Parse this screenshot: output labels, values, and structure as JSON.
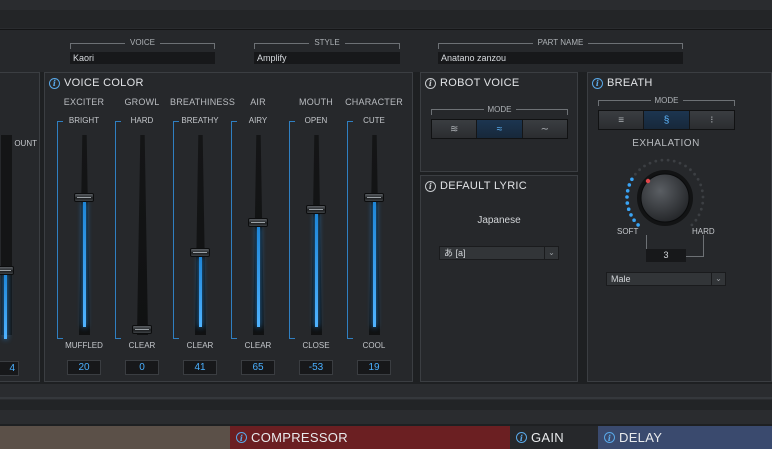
{
  "header": {
    "voice": {
      "caption": "VOICE",
      "value": "Kaori"
    },
    "style": {
      "caption": "STYLE",
      "value": "Amplify"
    },
    "part_name": {
      "caption": "PART NAME",
      "value": "Anatano zanzou"
    }
  },
  "left_partial": {
    "label": "OUNT",
    "value": "4"
  },
  "voice_color": {
    "title": "VOICE COLOR",
    "sliders": [
      {
        "name": "EXCITER",
        "top": "BRIGHT",
        "bottom": "MUFFLED",
        "value": "20",
        "level": 0.7
      },
      {
        "name": "GROWL",
        "top": "HARD",
        "bottom": "CLEAR",
        "value": "0",
        "level": 0.0
      },
      {
        "name": "BREATHINESS",
        "top": "BREATHY",
        "bottom": "CLEAR",
        "value": "41",
        "level": 0.41
      },
      {
        "name": "AIR",
        "top": "AIRY",
        "bottom": "CLEAR",
        "value": "65",
        "level": 0.57
      },
      {
        "name": "MOUTH",
        "top": "OPEN",
        "bottom": "CLOSE",
        "value": "-53",
        "level": 0.64
      },
      {
        "name": "CHARACTER",
        "top": "CUTE",
        "bottom": "COOL",
        "value": "19",
        "level": 0.7
      }
    ]
  },
  "robot_voice": {
    "title": "ROBOT VOICE",
    "mode_caption": "MODE",
    "modes": [
      {
        "icon": "wave-stack-icon",
        "glyph": "≋",
        "active": false
      },
      {
        "icon": "wave-double-icon",
        "glyph": "≈",
        "active": true
      },
      {
        "icon": "wave-single-icon",
        "glyph": "∼",
        "active": false
      }
    ]
  },
  "default_lyric": {
    "title": "DEFAULT LYRIC",
    "language": "Japanese",
    "selected": "あ [a]"
  },
  "breath": {
    "title": "BREATH",
    "mode_caption": "MODE",
    "modes": [
      {
        "icon": "wind-icon",
        "glyph": "≡",
        "active": false
      },
      {
        "icon": "wind-swirl-icon",
        "glyph": "§",
        "active": true
      },
      {
        "icon": "wind-dots-icon",
        "glyph": "⁝",
        "active": false
      }
    ],
    "knob_label": "EXHALATION",
    "soft": "SOFT",
    "hard": "HARD",
    "value": "3",
    "gender": "Male"
  },
  "fx_tabs": {
    "compressor": "COMPRESSOR",
    "gain": "GAIN",
    "delay": "DELAY"
  },
  "colors": {
    "accent": "#4ab0ff",
    "compressor": "#6b1f22",
    "delay": "#3a4a6e",
    "left_tab": "#5b5048"
  }
}
